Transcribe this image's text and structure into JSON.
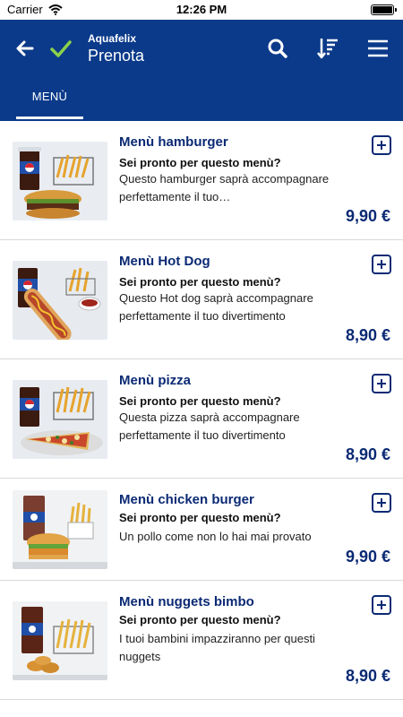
{
  "status_bar": {
    "carrier": "Carrier",
    "time": "12:26 PM"
  },
  "header": {
    "subtitle": "Aquafelix",
    "title": "Prenota"
  },
  "tabs": [
    {
      "label": "MENÙ"
    }
  ],
  "colors": {
    "brand": "#0b3a8a",
    "accent_check": "#8bd14a",
    "title_text": "#0b2a74"
  },
  "icons": [
    "back-arrow-icon",
    "check-icon",
    "search-icon",
    "sort-icon",
    "hamburger-menu-icon",
    "add-icon"
  ],
  "menu_items": [
    {
      "title": "Menù hamburger",
      "subtitle": "Sei pronto per questo menù?",
      "description": "Questo hamburger saprà accompagnare perfettamente il tuo…",
      "price": "9,90 €",
      "image": "hamburger-menu-photo"
    },
    {
      "title": "Menù Hot Dog",
      "subtitle": "Sei pronto per questo menù?",
      "description": "Questo Hot dog  saprà accompagnare perfettamente il tuo divertimento",
      "price": "8,90 €",
      "image": "hotdog-menu-photo"
    },
    {
      "title": "Menù pizza",
      "subtitle": "Sei pronto per questo menù?",
      "description": "Questa pizza saprà accompagnare perfettamente il tuo divertimento",
      "price": "8,90 €",
      "image": "pizza-menu-photo"
    },
    {
      "title": "Menù chicken burger",
      "subtitle": "Sei pronto per questo menù?",
      "description": "Un pollo come non lo hai mai provato",
      "price": "9,90 €",
      "image": "chicken-burger-menu-photo"
    },
    {
      "title": "Menù nuggets bimbo",
      "subtitle": "Sei pronto per questo menù?",
      "description": "I tuoi bambini impazziranno per questi nuggets",
      "price": "8,90 €",
      "image": "nuggets-menu-photo"
    }
  ]
}
